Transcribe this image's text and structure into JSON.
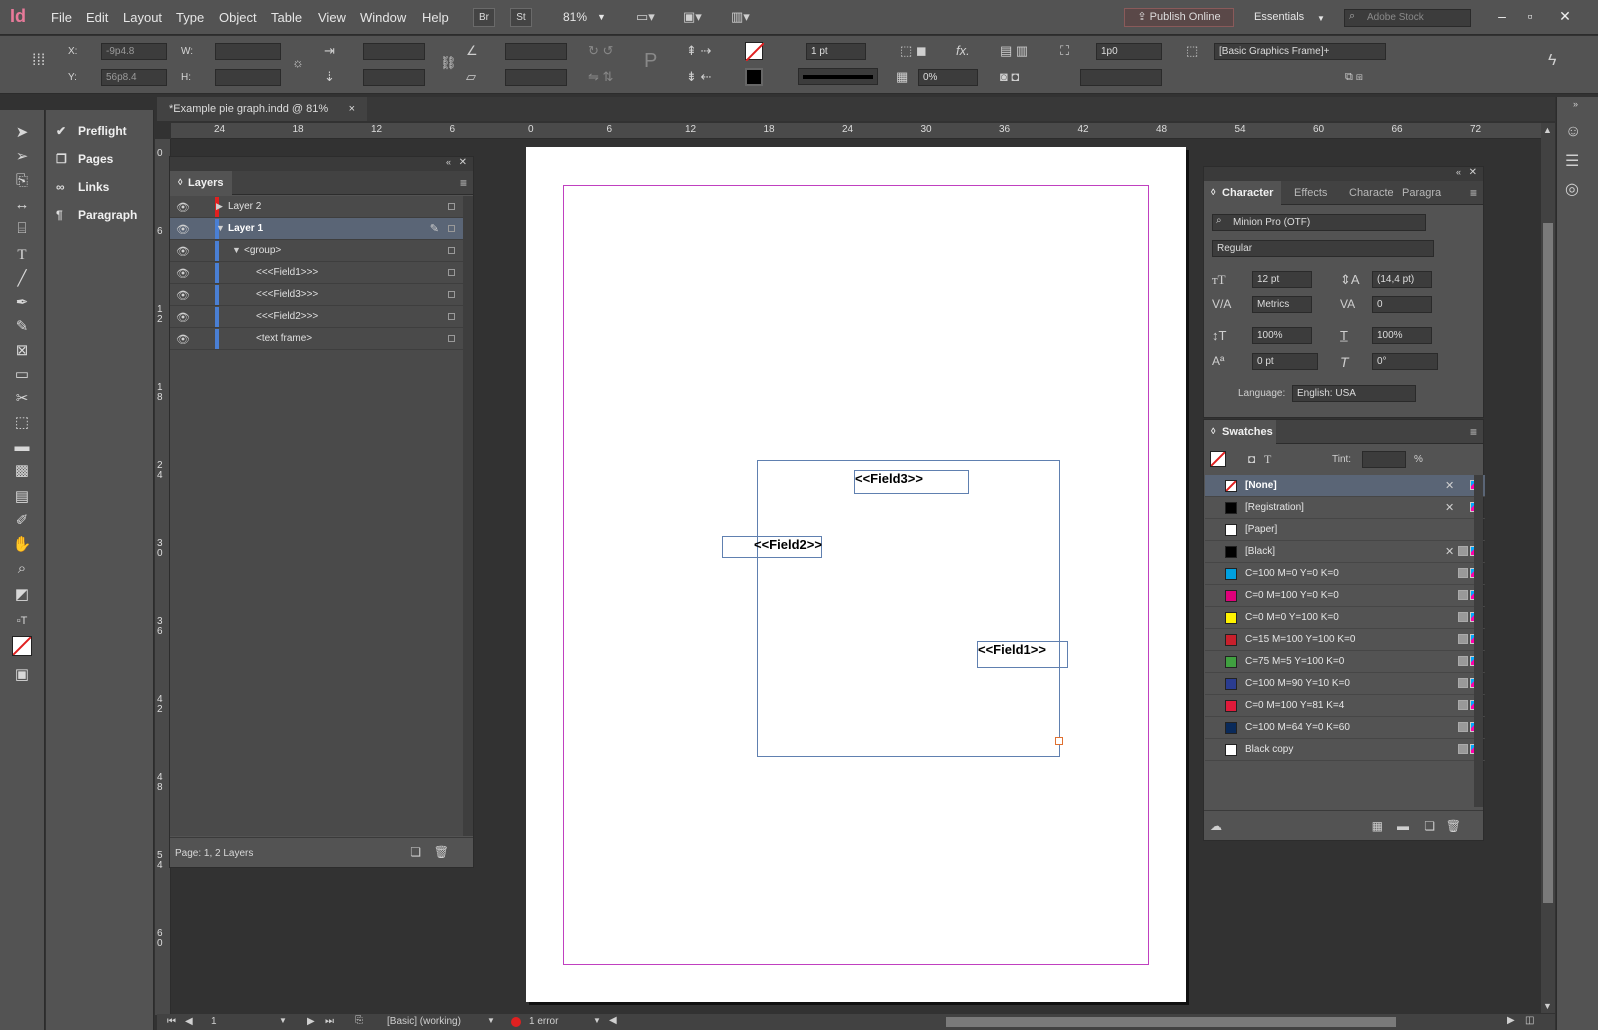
{
  "app": {
    "logo": "Id"
  },
  "menu": [
    "File",
    "Edit",
    "Layout",
    "Type",
    "Object",
    "Table",
    "View",
    "Window",
    "Help"
  ],
  "menubar": {
    "bridge": "Br",
    "stock": "St",
    "zoom": "81%",
    "publish": "Publish Online",
    "workspace": "Essentials",
    "search_placeholder": "Adobe Stock"
  },
  "control": {
    "x_label": "X:",
    "x_value": "-9p4.8",
    "y_label": "Y:",
    "y_value": "56p8.4",
    "w_label": "W:",
    "h_label": "H:",
    "stroke_weight": "1 pt",
    "opacity": "0%",
    "offset": "1p0",
    "object_style": "[Basic Graphics Frame]+"
  },
  "document_tab": {
    "title": "*Example pie graph.indd @ 81%",
    "close": "×"
  },
  "ruler_h": [
    "24",
    "18",
    "12",
    "6",
    "0",
    "6",
    "12",
    "18",
    "24",
    "30",
    "36",
    "42",
    "48",
    "54",
    "60",
    "66",
    "72"
  ],
  "ruler_v": [
    "0",
    "6",
    "1 2",
    "1 8",
    "2 4",
    "3 0",
    "3 6",
    "4 2",
    "4 8",
    "5 4",
    "6 0"
  ],
  "dock": [
    {
      "label": "Preflight",
      "icon": "preflight-icon"
    },
    {
      "label": "Pages",
      "icon": "pages-icon"
    },
    {
      "label": "Links",
      "icon": "links-icon"
    },
    {
      "label": "Paragraph",
      "icon": "paragraph-icon"
    }
  ],
  "canvas": {
    "field1": "<<Field1>>",
    "field2": "<<Field2>>",
    "field3": "<<Field3>>"
  },
  "layers": {
    "title": "Layers",
    "rows": [
      {
        "label": "Layer 2",
        "color": "#e02020"
      },
      {
        "label": "Layer 1",
        "color": "#4a7fd4"
      },
      {
        "label": "<group>",
        "color": "#4a7fd4"
      },
      {
        "label": "<<<Field1>>>",
        "color": "#4a7fd4"
      },
      {
        "label": "<<<Field3>>>",
        "color": "#4a7fd4"
      },
      {
        "label": "<<<Field2>>>",
        "color": "#4a7fd4"
      },
      {
        "label": "<text frame>",
        "color": "#4a7fd4"
      }
    ],
    "footer": "Page: 1, 2 Layers"
  },
  "character": {
    "tabs": [
      "Character",
      "Effects",
      "Characte",
      "Paragra"
    ],
    "font": "Minion Pro (OTF)",
    "style": "Regular",
    "size": "12 pt",
    "leading": "(14,4 pt)",
    "kerning": "Metrics",
    "tracking": "0",
    "vscale": "100%",
    "hscale": "100%",
    "baseline": "0 pt",
    "skew": "0°",
    "language_label": "Language:",
    "language": "English: USA"
  },
  "swatches": {
    "title": "Swatches",
    "tint_label": "Tint:",
    "tint_unit": "%",
    "items": [
      {
        "name": "[None]",
        "color": "none"
      },
      {
        "name": "[Registration]",
        "color": "#000000"
      },
      {
        "name": "[Paper]",
        "color": "#ffffff"
      },
      {
        "name": "[Black]",
        "color": "#000000"
      },
      {
        "name": "C=100 M=0 Y=0 K=0",
        "color": "#00a0e0"
      },
      {
        "name": "C=0 M=100 Y=0 K=0",
        "color": "#e0007a"
      },
      {
        "name": "C=0 M=0 Y=100 K=0",
        "color": "#fff200"
      },
      {
        "name": "C=15 M=100 Y=100 K=0",
        "color": "#c8202c"
      },
      {
        "name": "C=75 M=5 Y=100 K=0",
        "color": "#40a040"
      },
      {
        "name": "C=100 M=90 Y=10 K=0",
        "color": "#2a3c90"
      },
      {
        "name": "C=0 M=100 Y=81 K=4",
        "color": "#e01a3a"
      },
      {
        "name": "C=100 M=64 Y=0 K=60",
        "color": "#0a2a5a"
      },
      {
        "name": "Black copy",
        "color": "#ffffff"
      }
    ]
  },
  "status": {
    "page": "1",
    "style": "[Basic] (working)",
    "errors": "1 error"
  }
}
